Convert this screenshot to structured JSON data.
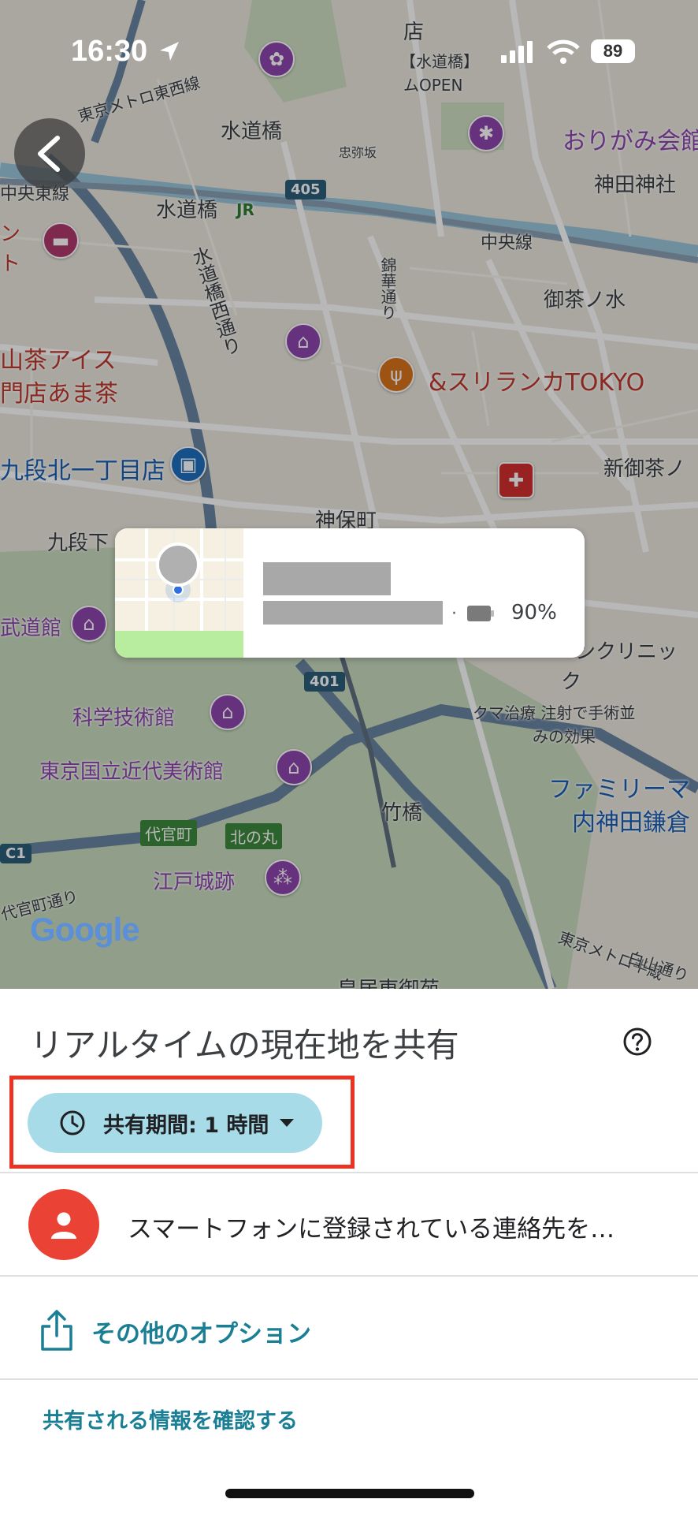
{
  "status_bar": {
    "time": "16:30",
    "battery": "89"
  },
  "map": {
    "labels": {
      "suidobashi_north": "水道橋",
      "suidobashi_station": "水道橋",
      "jr": "JR",
      "tozai_line": "東京メトロ東西線",
      "chuo_line_left": "中央東線",
      "chuo_line": "中央線",
      "suidobashi_nishi": "水道橋西通り",
      "ochanomizu": "御茶ノ水",
      "kanda_shrine": "神田神社",
      "origami": "おりがみ会館",
      "suidobashi_open_1": "【水道橋】",
      "suidobashi_open_2": "ムOPEN",
      "shop_top": "店",
      "wo_tokyo": "&スリランカTOKYO",
      "amacha": "山茶アイス",
      "amacha2": "門店あま茶",
      "kudan": "九段北一丁目店",
      "kudanshita": "九段下",
      "jimbocho": "神保町",
      "shinochanomizu": "新御茶ノ",
      "budokan": "武道館",
      "science": "科学技術館",
      "momat": "東京国立近代美術館",
      "takebashi": "竹橋",
      "daikancho": "代官町",
      "kitanomaru": "北の丸",
      "edo_castle": "江戸城跡",
      "daikancho_dori": "代官町通り",
      "hanzomon_line": "東京メトロ半蔵",
      "kokyo": "皇居東御苑",
      "clinic": "ンクリニッ",
      "clinic2": "ク",
      "kuma": "クマ治療 注射で手術並",
      "kuma2": "みの効果",
      "familymart": "ファミリーマ",
      "familymart2": "内神田鎌倉",
      "route405": "405",
      "route401": "401",
      "chuo_dori": "白山通り",
      "nishikicho": "錦華通り",
      "left_red": "ン",
      "left_red2": "ト",
      "c1": "C1",
      "tadoku": "忠弥坂"
    },
    "google_logo": "Google"
  },
  "location_card": {
    "battery_pct": "90%"
  },
  "sheet": {
    "title": "リアルタイムの現在地を共有",
    "duration_label": "共有期間: 1 時間",
    "contact_prompt": "スマートフォンに登録されている連絡先を…",
    "more_options": "その他のオプション",
    "review_info": "共有される情報を確認する"
  },
  "colors": {
    "accent_teal": "#1a7f94",
    "chip_bg": "#a8dbe8",
    "highlight_red": "#ea3323",
    "avatar_red": "#ea4335"
  }
}
